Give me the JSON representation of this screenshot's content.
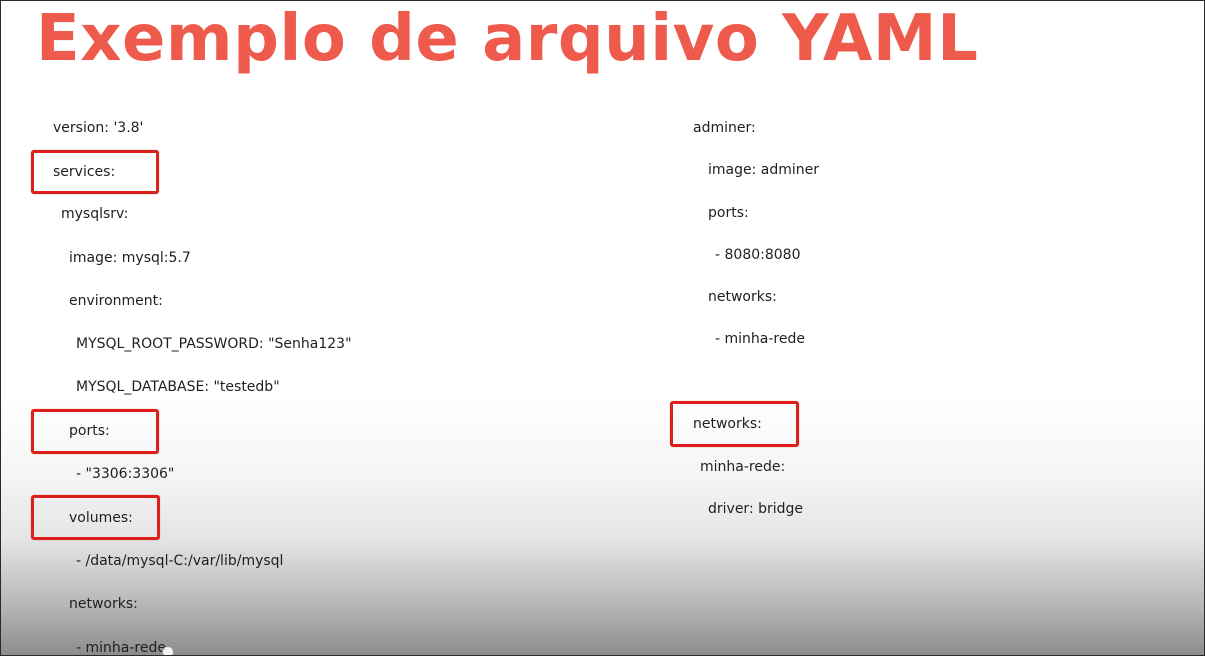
{
  "slide": {
    "title": "Exemplo de arquivo YAML",
    "colors": {
      "title": "#ee5b4c",
      "highlight": "#d9201a",
      "text": "#1f1f1f"
    },
    "left_column": [
      "version: '3.8'",
      "services:",
      "mysqlsrv:",
      "image: mysql:5.7",
      "environment:",
      "MYSQL_ROOT_PASSWORD: \"Senha123\"",
      "MYSQL_DATABASE: \"testedb\"",
      "ports:",
      "- \"3306:3306\"",
      "volumes:",
      "- /data/mysql-C:/var/lib/mysql",
      "networks:",
      "- minha-rede"
    ],
    "right_column": [
      "adminer:",
      "image: adminer",
      "ports:",
      "- 8080:8080",
      "networks:",
      "- minha-rede",
      "networks:",
      "minha-rede:",
      "driver: bridge"
    ],
    "highlighted_keys": [
      "services:",
      "ports:",
      "volumes:",
      "networks:"
    ]
  }
}
